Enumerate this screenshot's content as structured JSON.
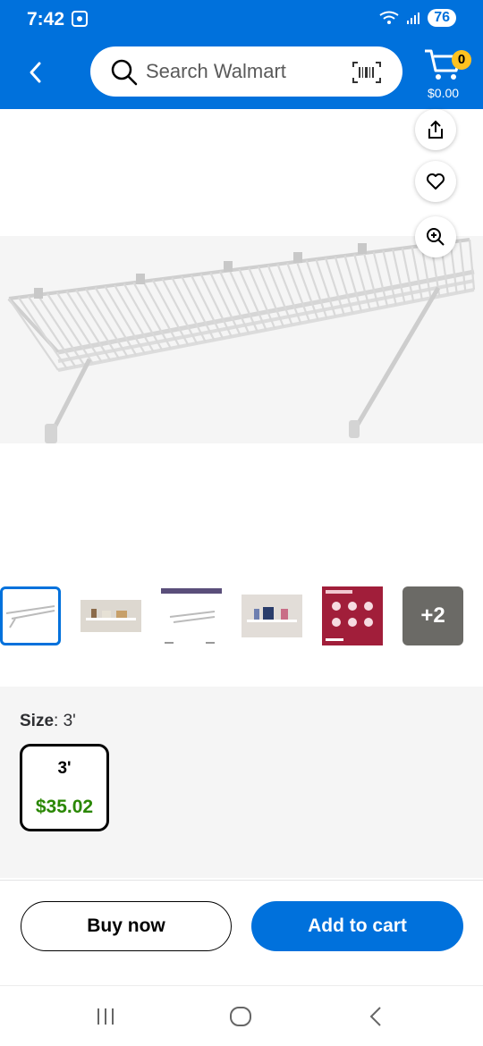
{
  "status_bar": {
    "time": "7:42",
    "battery": "76"
  },
  "header": {
    "search_placeholder": "Search Walmart",
    "cart_count": "0",
    "cart_total": "$0.00"
  },
  "gallery": {
    "thumbnails": [
      {
        "name": "thumb-shelf-main",
        "selected": true
      },
      {
        "name": "thumb-shelf-kitchen"
      },
      {
        "name": "thumb-shelf-diagram"
      },
      {
        "name": "thumb-shelf-bath"
      },
      {
        "name": "thumb-fixed-mount"
      }
    ],
    "more_label": "+2"
  },
  "size": {
    "label": "Size",
    "selected_value": ": 3'",
    "option_name": "3'",
    "option_price": "$35.02"
  },
  "actions": {
    "buy_now": "Buy now",
    "add_to_cart": "Add to cart"
  },
  "colors": {
    "brand_blue": "#0071dc",
    "price_green": "#2a8703",
    "badge_yellow": "#ffc220"
  }
}
